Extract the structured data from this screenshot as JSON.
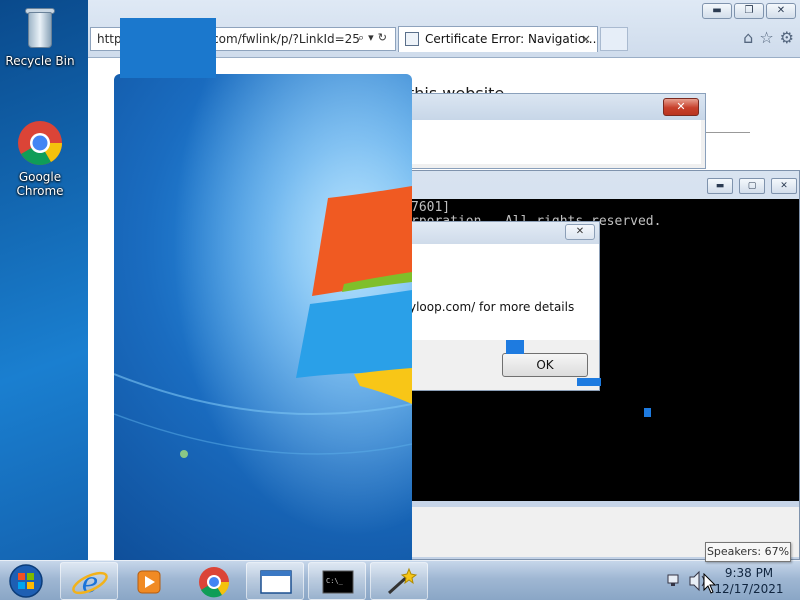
{
  "desktop": {
    "icons": [
      {
        "label": "Recycle Bin"
      },
      {
        "label": "Google Chrome"
      }
    ]
  },
  "browser": {
    "address": "http://go.microsoft.com/fwlink/p/?LinkId=25",
    "tab_title": "Certificate Error: Navigatio...",
    "tab_close": "×",
    "page_title_fragment": "this website",
    "window_controls": {
      "minimize": "▬",
      "restore": "❐",
      "close": "✕"
    }
  },
  "cmd": {
    "lines": [
      "7601]",
      "rporation.  All rights reserved."
    ],
    "window_controls": {
      "minimize": "▬",
      "restore": "▢",
      "close": "✕"
    }
  },
  "dialog": {
    "message": "yloop.com/ for more details",
    "ok_label": "OK",
    "close_label": "✕"
  },
  "taskbar": {
    "items": [
      {
        "name": "internet-explorer"
      },
      {
        "name": "windows-media-player"
      },
      {
        "name": "google-chrome"
      },
      {
        "name": "window"
      },
      {
        "name": "command-prompt"
      },
      {
        "name": "wizard"
      }
    ],
    "clock_time": "9:38 PM",
    "clock_date": "12/17/2021",
    "tooltip": "Speakers: 67%"
  }
}
